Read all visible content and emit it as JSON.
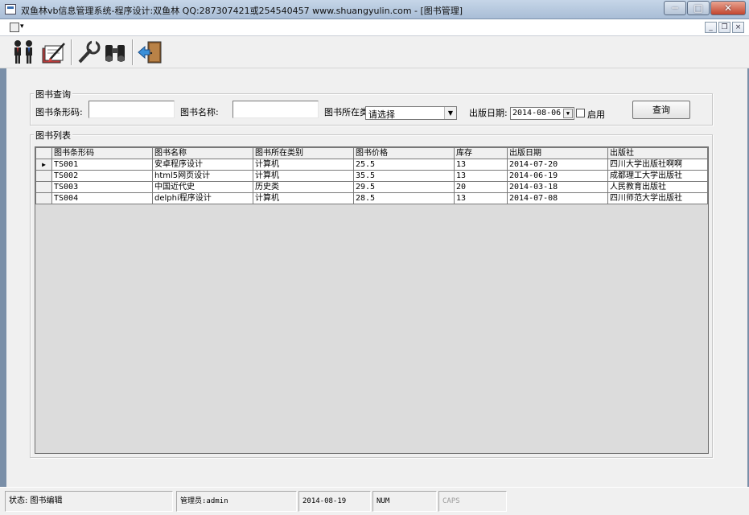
{
  "window": {
    "title": "双鱼林vb信息管理系统-程序设计:双鱼林 QQ:287307421或254540457 www.shuangyulin.com - [图书管理]"
  },
  "winbtns": {
    "minimize": "─",
    "maximize": "□",
    "close": "✕"
  },
  "mdibar": {
    "minimize": "_",
    "restore": "❐",
    "close": "×"
  },
  "toolbar": {
    "buttons": [
      {
        "name": "users-icon"
      },
      {
        "name": "edit-book-icon"
      },
      {
        "name": "wrench-icon"
      },
      {
        "name": "binoculars-icon"
      },
      {
        "name": "exit-door-icon"
      }
    ]
  },
  "query": {
    "legend": "图书查询",
    "barcode_label": "图书条形码:",
    "barcode_value": "",
    "name_label": "图书名称:",
    "name_value": "",
    "category_label": "图书所在类",
    "category_value": "请选择",
    "pubdate_label": "出版日期:",
    "pubdate_value": "2014-08-06",
    "enable_label": "启用",
    "search_button": "查询"
  },
  "list": {
    "legend": "图书列表",
    "columns": [
      "图书条形码",
      "图书名称",
      "图书所在类别",
      "图书价格",
      "库存",
      "出版日期",
      "出版社"
    ],
    "rows": [
      {
        "marker": "▶",
        "cells": [
          "TS001",
          "安卓程序设计",
          "计算机",
          "25.5",
          "13",
          "2014-07-20",
          "四川大学出版社啊啊"
        ]
      },
      {
        "marker": "",
        "cells": [
          "TS002",
          "html5网页设计",
          "计算机",
          "35.5",
          "13",
          "2014-06-19",
          "成都理工大学出版社"
        ]
      },
      {
        "marker": "",
        "cells": [
          "TS003",
          "中国近代史",
          "历史类",
          "29.5",
          "20",
          "2014-03-18",
          "人民教育出版社"
        ]
      },
      {
        "marker": "",
        "cells": [
          "TS004",
          "delphi程序设计",
          "计算机",
          "28.5",
          "13",
          "2014-07-08",
          "四川师范大学出版社"
        ]
      }
    ]
  },
  "status": {
    "state": "状态:  图书编辑",
    "admin": "管理员:admin",
    "date": "2014-08-19",
    "num": "NUM",
    "caps": "CAPS"
  }
}
